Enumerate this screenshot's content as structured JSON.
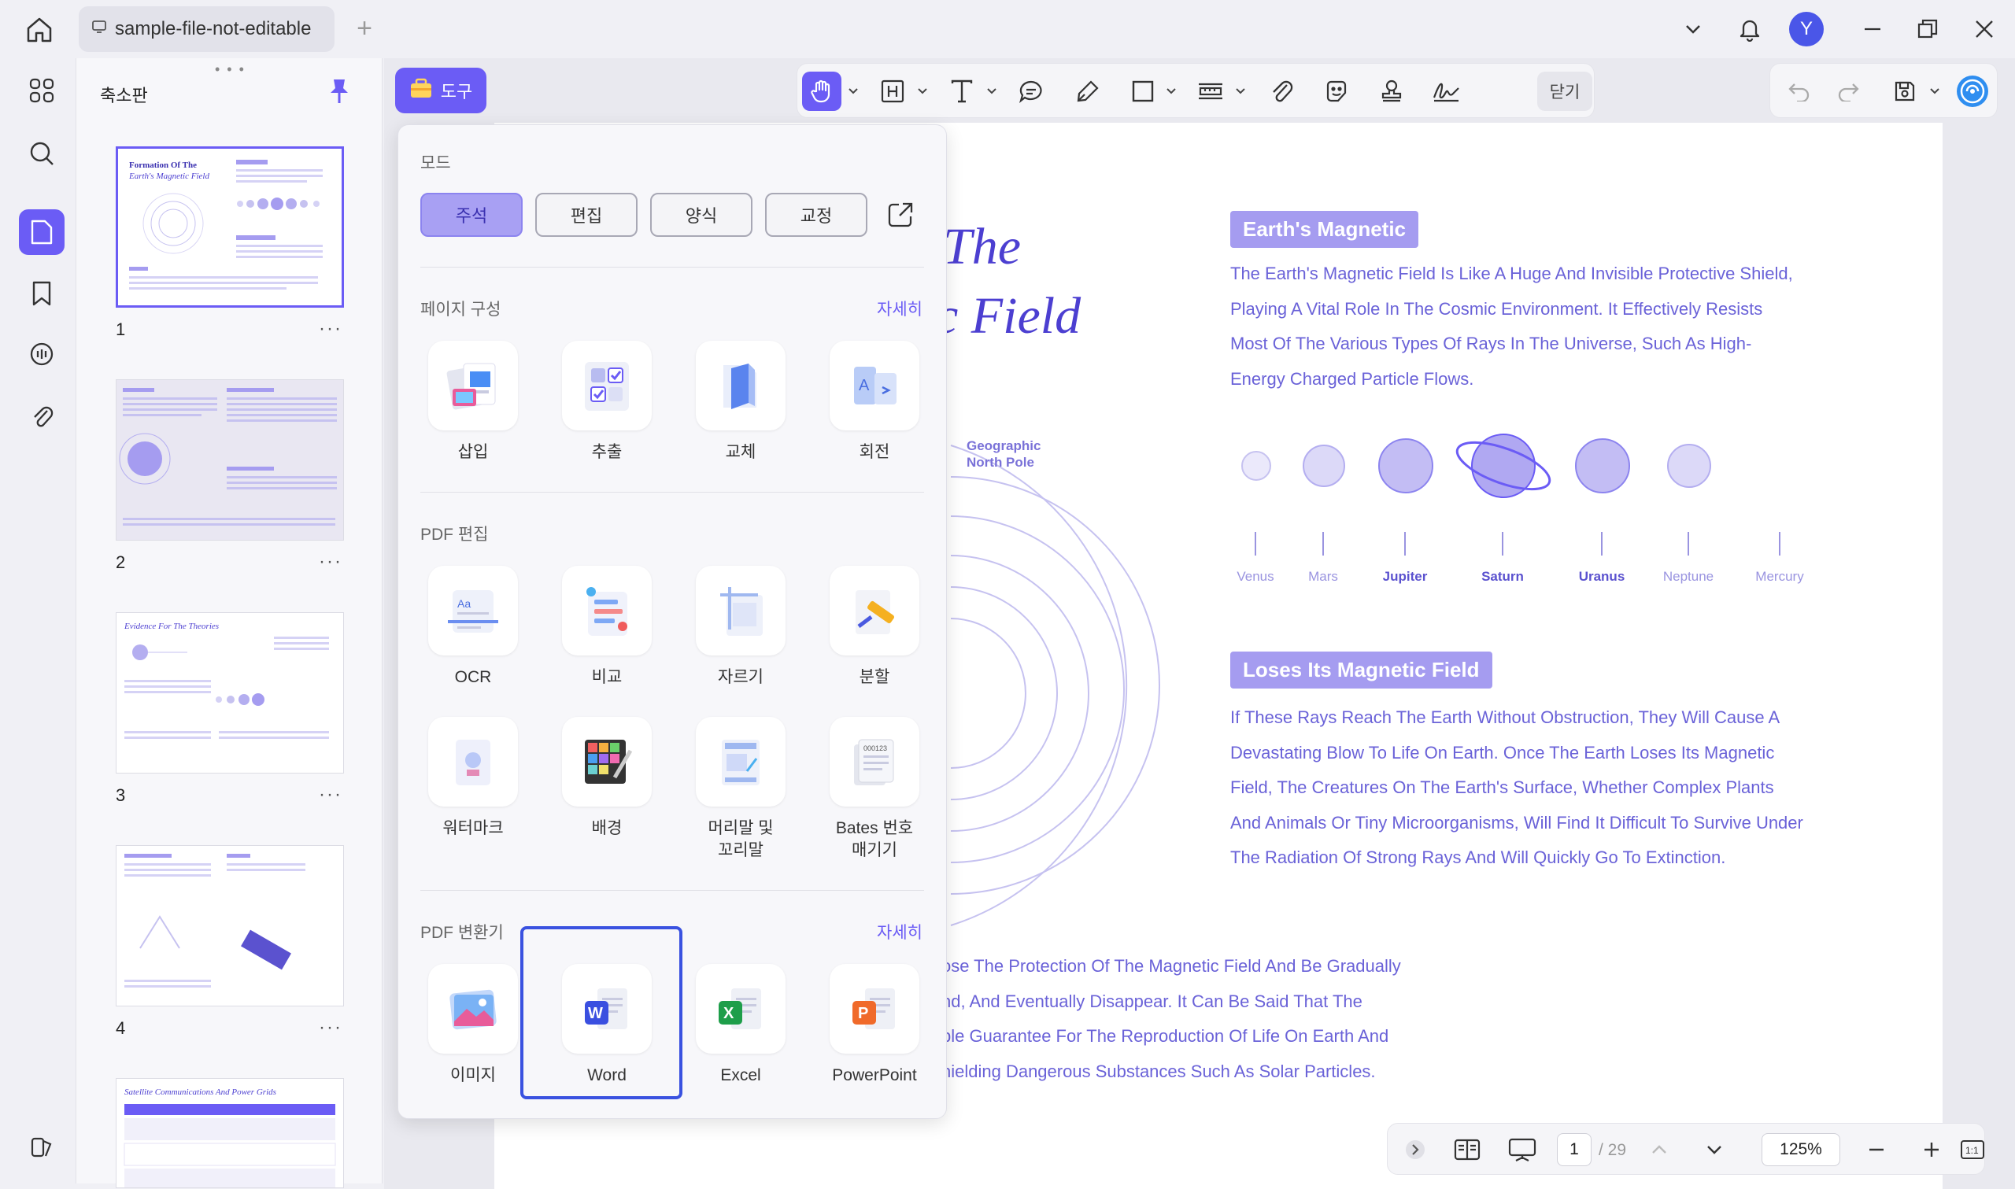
{
  "window": {
    "tab_title": "sample-file-not-editable",
    "avatar_letter": "Y"
  },
  "thumbnails": {
    "title": "축소판",
    "more": "···",
    "pages": [
      {
        "number": "1",
        "heading": "Formation Of The Earth's Magnetic Field"
      },
      {
        "number": "2",
        "heading": ""
      },
      {
        "number": "3",
        "heading": "Evidence For The Theories"
      },
      {
        "number": "4",
        "heading": ""
      },
      {
        "number": "",
        "heading": "Satellite Communications And Power Grids"
      }
    ]
  },
  "toolbar": {
    "tools_label": "도구",
    "close_label": "닫기"
  },
  "document": {
    "title_line1": "The",
    "title_line2": "c Field",
    "tag1": "Earth's Magnetic",
    "para1": "The Earth's Magnetic Field Is Like A Huge And Invisible Protective Shield, Playing A Vital Role In The Cosmic Environment. It Effectively Resists Most Of The Various Types Of Rays In The Universe, Such As High-Energy Charged Particle Flows.",
    "pole_label_1": "Geographic",
    "pole_label_2": "North Pole",
    "planets": [
      "Venus",
      "Mars",
      "Jupiter",
      "Saturn",
      "Uranus",
      "Neptune",
      "Mercury"
    ],
    "tag2": "Loses Its Magnetic Field",
    "para2": "If These Rays Reach The Earth Without Obstruction, They Will Cause A Devastating Blow To Life On Earth. Once The Earth Loses Its Magnetic Field, The Creatures On The Earth's Surface, Whether Complex Plants And Animals Or Tiny Microorganisms, Will Find It Difficult To Survive Under The Radiation Of Strong Rays And Will Quickly Go To Extinction.",
    "para3_lines": [
      "ose The Protection Of The Magnetic Field And Be Gradually",
      "nd, And Eventually Disappear. It Can Be Said That The",
      "ble Guarantee For The Reproduction Of Life On Earth And",
      "hielding Dangerous Substances Such As Solar Particles."
    ]
  },
  "panel": {
    "mode_title": "모드",
    "modes": [
      {
        "label": "주석",
        "active": true
      },
      {
        "label": "편집",
        "active": false
      },
      {
        "label": "양식",
        "active": false
      },
      {
        "label": "교정",
        "active": false
      }
    ],
    "page_section": {
      "title": "페이지 구성",
      "more": "자세히",
      "items": [
        "삽입",
        "추출",
        "교체",
        "회전"
      ]
    },
    "edit_section": {
      "title": "PDF 편집",
      "row1": [
        "OCR",
        "비교",
        "자르기",
        "분할"
      ],
      "row2": [
        "워터마크",
        "배경",
        "머리말 및\n꼬리말",
        "Bates 번호\n매기기"
      ]
    },
    "convert_section": {
      "title": "PDF 변환기",
      "more": "자세히",
      "items": [
        "이미지",
        "Word",
        "Excel",
        "PowerPoint"
      ]
    }
  },
  "navigator": {
    "page": "1",
    "total": "/ 29",
    "zoom": "125%"
  },
  "colors": {
    "accent": "#6b5cf5",
    "doc_text": "#6a62d8",
    "selection_border": "#3a52e0"
  }
}
